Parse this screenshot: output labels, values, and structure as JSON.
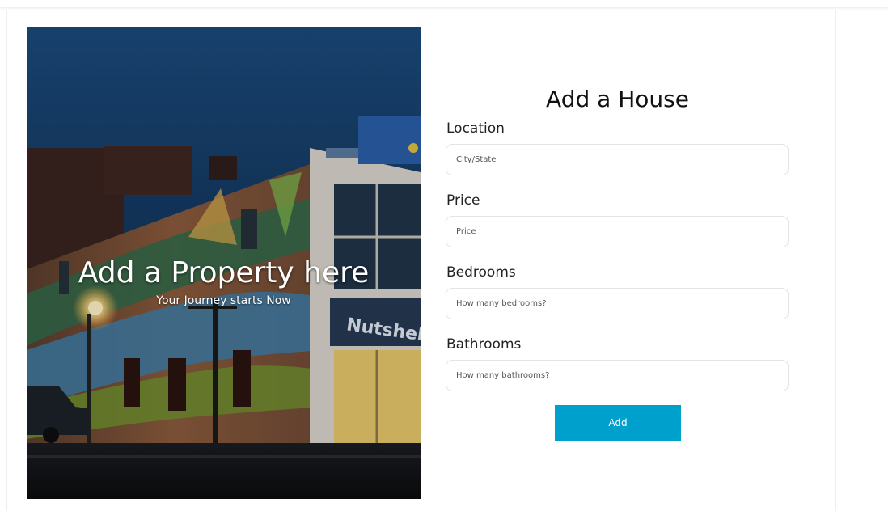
{
  "hero": {
    "title": "Add a Property here",
    "subtitle": "Your Journey starts Now",
    "sign_text": "Nutshell"
  },
  "form": {
    "title": "Add a House",
    "fields": [
      {
        "label": "Location",
        "placeholder": "City/State",
        "value": ""
      },
      {
        "label": "Price",
        "placeholder": "Price",
        "value": ""
      },
      {
        "label": "Bedrooms",
        "placeholder": "How many bedrooms?",
        "value": ""
      },
      {
        "label": "Bathrooms",
        "placeholder": "How many bathrooms?",
        "value": ""
      }
    ],
    "submit_label": "Add"
  },
  "colors": {
    "accent": "#00a0cc",
    "sky": "#163f6e"
  }
}
